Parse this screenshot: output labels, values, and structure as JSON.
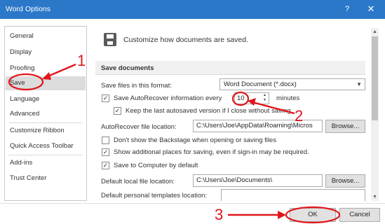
{
  "window": {
    "title": "Word Options",
    "help_glyph": "?",
    "close_glyph": "✕",
    "title_bar_color": "#2b78c9"
  },
  "sidebar": {
    "items": [
      {
        "label": "General"
      },
      {
        "label": "Display"
      },
      {
        "label": "Proofing"
      },
      {
        "label": "Save",
        "selected": true
      },
      {
        "label": "Language"
      },
      {
        "label": "Advanced"
      },
      {
        "label": "Customize Ribbon"
      },
      {
        "label": "Quick Access Toolbar"
      },
      {
        "label": "Add-ins"
      },
      {
        "label": "Trust Center"
      }
    ]
  },
  "main": {
    "header": "Customize how documents are saved.",
    "header_icon": "save-disk-icon",
    "section_title": "Save documents",
    "save_format": {
      "label": "Save files in this format:",
      "value": "Word Document (*.docx)"
    },
    "autorecover": {
      "label": "Save AutoRecover information every",
      "checked": true,
      "minutes_value": "10",
      "minutes_label": "minutes"
    },
    "keep_last": {
      "label": "Keep the last autosaved version if I close without saving",
      "checked": true
    },
    "autorecover_location": {
      "label": "AutoRecover file location:",
      "value": "C:\\Users\\Joe\\AppData\\Roaming\\Micros",
      "browse_label": "Browse..."
    },
    "dont_show_backstage": {
      "label": "Don't show the Backstage when opening or saving files",
      "checked": false
    },
    "show_additional_places": {
      "label": "Show additional places for saving, even if sign-in may be required.",
      "checked": true
    },
    "save_to_computer": {
      "label": "Save to Computer by default",
      "checked": true
    },
    "default_local_location": {
      "label": "Default local file location:",
      "value": "C:\\Users\\Joe\\Documents\\",
      "browse_label": "Browse..."
    },
    "default_templates_location": {
      "label": "Default personal templates location:",
      "value": ""
    }
  },
  "footer": {
    "ok_label": "OK",
    "cancel_label": "Cancel"
  },
  "annotations": {
    "color": "#e0161c",
    "labels": [
      "1",
      "2",
      "3"
    ]
  }
}
